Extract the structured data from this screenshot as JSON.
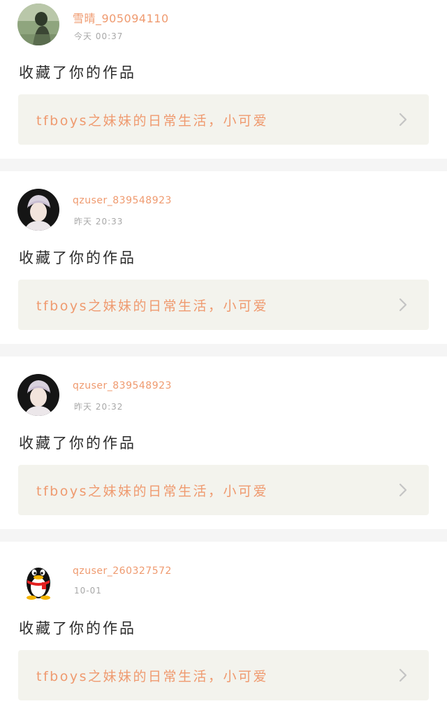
{
  "notifications": [
    {
      "username": "雪晴_905094110",
      "time": "今天 00:37",
      "action": "收藏了你的作品",
      "work_title": "tfboys之妹妹的日常生活，小可爱",
      "avatar": "photo-avatar"
    },
    {
      "username": "qzuser_839548923",
      "time": "昨天 20:33",
      "action": "收藏了你的作品",
      "work_title": "tfboys之妹妹的日常生活，小可爱",
      "avatar": "photo-avatar"
    },
    {
      "username": "qzuser_839548923",
      "time": "昨天 20:32",
      "action": "收藏了你的作品",
      "work_title": "tfboys之妹妹的日常生活，小可爱",
      "avatar": "photo-avatar"
    },
    {
      "username": "qzuser_260327572",
      "time": "10-01",
      "action": "收藏了你的作品",
      "work_title": "tfboys之妹妹的日常生活，小可爱",
      "avatar": "qq-penguin-icon"
    }
  ],
  "colors": {
    "accent": "#ef9a6f",
    "time": "#a8a8a8",
    "text": "#2b2b2b",
    "link_bg": "#f3f3ed",
    "separator": "#f5f5f5"
  },
  "icons": {
    "arrow": "chevron-right-icon"
  }
}
